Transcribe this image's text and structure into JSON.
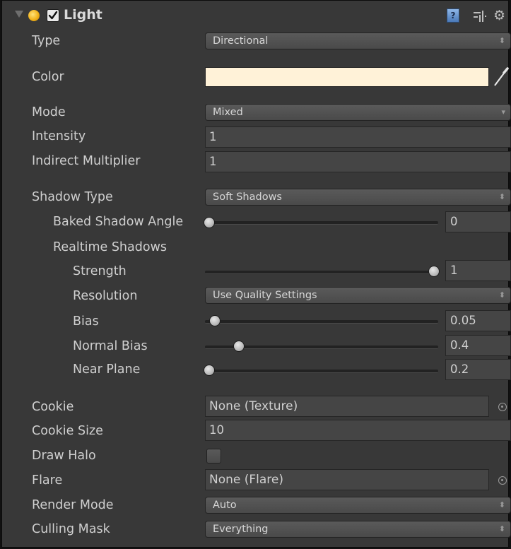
{
  "component": {
    "title": "Light",
    "enabled": true,
    "icons": [
      "foldout-arrow-icon",
      "light-bulb-icon",
      "help-book-icon",
      "preset-sliders-icon",
      "gear-icon"
    ]
  },
  "properties": {
    "type": {
      "label": "Type",
      "value": "Directional"
    },
    "color": {
      "label": "Color",
      "value": "#FFF2D8"
    },
    "mode": {
      "label": "Mode",
      "value": "Mixed"
    },
    "intensity": {
      "label": "Intensity",
      "value": "1"
    },
    "indirect_multiplier": {
      "label": "Indirect Multiplier",
      "value": "1"
    },
    "shadow_type": {
      "label": "Shadow Type",
      "value": "Soft Shadows"
    },
    "baked_shadow_angle": {
      "label": "Baked Shadow Angle",
      "value": "0",
      "slider_fraction": 0.0
    },
    "realtime_shadows": {
      "label": "Realtime Shadows"
    },
    "strength": {
      "label": "Strength",
      "value": "1",
      "slider_fraction": 1.0
    },
    "resolution": {
      "label": "Resolution",
      "value": "Use Quality Settings"
    },
    "bias": {
      "label": "Bias",
      "value": "0.05",
      "slider_fraction": 0.025
    },
    "normal_bias": {
      "label": "Normal Bias",
      "value": "0.4",
      "slider_fraction": 0.13
    },
    "near_plane": {
      "label": "Near Plane",
      "value": "0.2",
      "slider_fraction": 0.0
    },
    "cookie": {
      "label": "Cookie",
      "value": "None (Texture)"
    },
    "cookie_size": {
      "label": "Cookie Size",
      "value": "10"
    },
    "draw_halo": {
      "label": "Draw Halo",
      "checked": false
    },
    "flare": {
      "label": "Flare",
      "value": "None (Flare)"
    },
    "render_mode": {
      "label": "Render Mode",
      "value": "Auto"
    },
    "culling_mask": {
      "label": "Culling Mask",
      "value": "Everything"
    }
  }
}
